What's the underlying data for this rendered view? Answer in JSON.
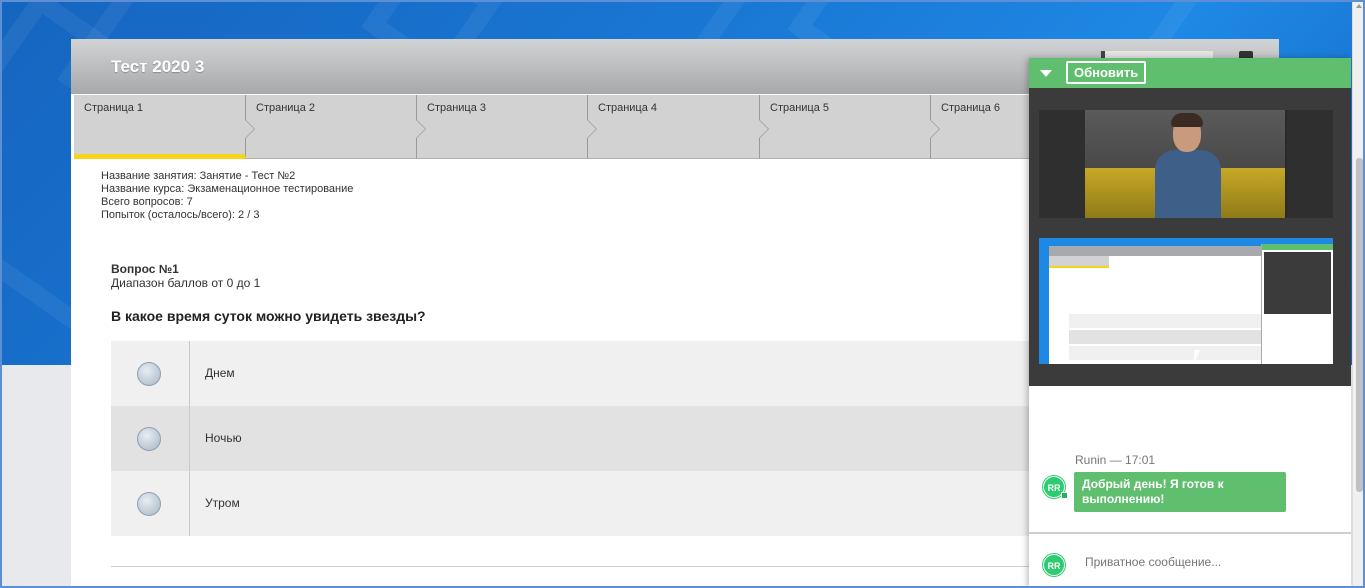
{
  "panel": {
    "title": "Тест 2020 3",
    "tabs": [
      "Страница 1",
      "Страница 2",
      "Страница 3",
      "Страница 4",
      "Страница 5",
      "Страница 6"
    ],
    "active_tab": 0
  },
  "info": {
    "lesson": "Название занятия: Занятие - Тест №2",
    "course": "Название курса: Экзаменационное тестирование",
    "total": "Всего вопросов: 7",
    "attempts": "Попыток (осталось/всего): 2 / 3"
  },
  "question": {
    "number": "Вопрос №1",
    "range": "Диапазон баллов от 0 до 1",
    "text": "В какое время суток можно увидеть звезды?",
    "answers": [
      "Днем",
      "Ночью",
      "Утром"
    ]
  },
  "widget": {
    "refresh_label": "Обновить",
    "chat_author": "Runin",
    "chat_separator": "—",
    "chat_time": "17:01",
    "avatar_initials": "RR",
    "message": "Добрый день! Я готов к выполнению!",
    "private_placeholder": "Приватное сообщение..."
  },
  "colors": {
    "accent_green": "#5fbf6e",
    "tab_active": "#f5d41b",
    "background_blue": "#1976d2"
  }
}
